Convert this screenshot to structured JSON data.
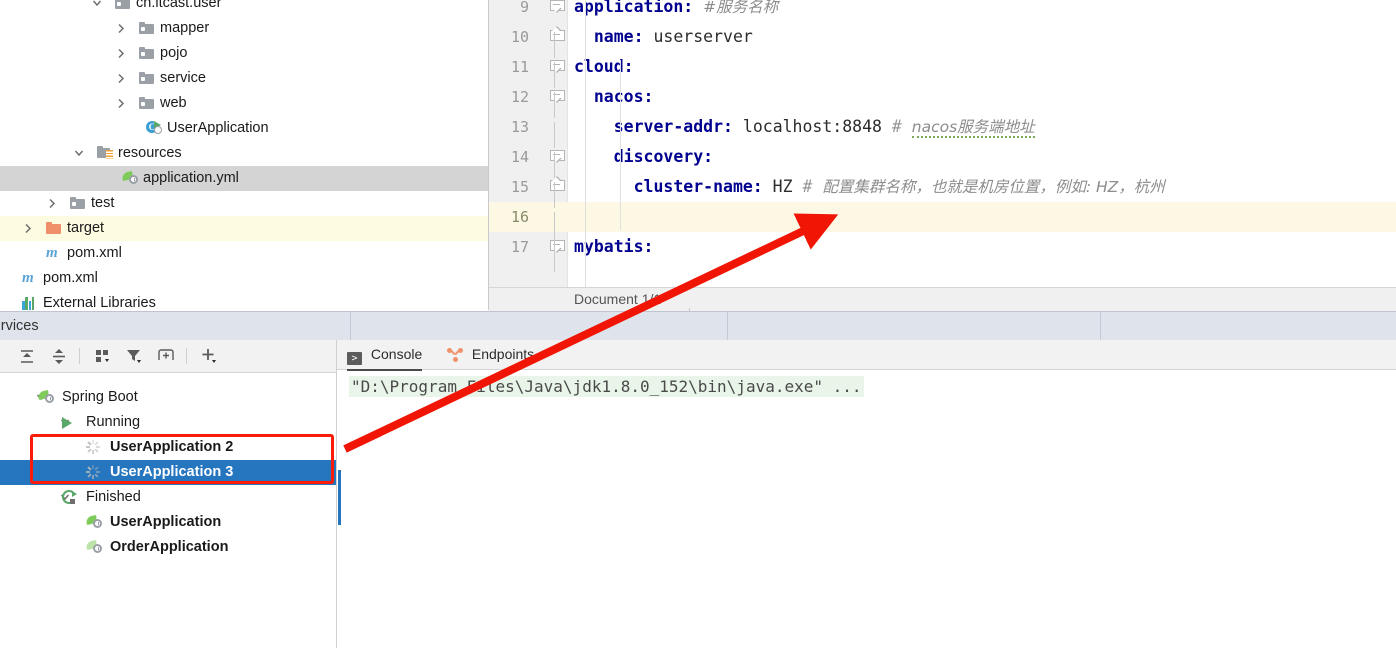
{
  "project_tree": {
    "rows": [
      {
        "label": "cn.itcast.user",
        "icon": "package-icon",
        "indent": 115,
        "arrow": "chevron-down",
        "state": "partial-top"
      },
      {
        "label": "mapper",
        "icon": "folder-grey-icon",
        "indent": 139,
        "arrow": "chevron-right"
      },
      {
        "label": "pojo",
        "icon": "folder-grey-icon",
        "indent": 139,
        "arrow": "chevron-right"
      },
      {
        "label": "service",
        "icon": "folder-grey-icon",
        "indent": 139,
        "arrow": "chevron-right"
      },
      {
        "label": "web",
        "icon": "folder-grey-icon",
        "indent": 139,
        "arrow": "chevron-right"
      },
      {
        "label": "UserApplication",
        "icon": "java-class-run-icon",
        "indent": 146,
        "arrow": ""
      },
      {
        "label": "resources",
        "icon": "folder-resources-icon",
        "indent": 97,
        "arrow": "chevron-down"
      },
      {
        "label": "application.yml",
        "icon": "spring-yaml-icon",
        "indent": 122,
        "arrow": "",
        "selected": true
      },
      {
        "label": "test",
        "icon": "folder-grey-icon",
        "indent": 70,
        "arrow": "chevron-right"
      },
      {
        "label": "target",
        "icon": "folder-orange-icon",
        "indent": 46,
        "arrow": "chevron-right",
        "highlighted": true
      },
      {
        "label": "pom.xml",
        "icon": "maven-m-icon",
        "indent": 46,
        "arrow": ""
      },
      {
        "label": "pom.xml",
        "icon": "maven-m-icon",
        "indent": 22,
        "arrow": ""
      },
      {
        "label": "External Libraries",
        "icon": "external-libraries-icon",
        "indent": 22,
        "arrow": ""
      }
    ]
  },
  "editor": {
    "lines": [
      {
        "num": "9",
        "indent": 0,
        "fold": "down",
        "parts": [
          {
            "t": "application:",
            "c": "k"
          },
          {
            "t": " ",
            "c": "v"
          },
          {
            "t": "#服务名称",
            "c": "cmw"
          }
        ]
      },
      {
        "num": "10",
        "indent": 0,
        "fold": "up",
        "parts": [
          {
            "t": "  name:",
            "c": "k"
          },
          {
            "t": " userserver",
            "c": "v"
          }
        ]
      },
      {
        "num": "11",
        "indent": 0,
        "fold": "down",
        "parts": [
          {
            "t": "cloud:",
            "c": "k"
          }
        ]
      },
      {
        "num": "12",
        "indent": 0,
        "fold": "down",
        "parts": [
          {
            "t": "  nacos:",
            "c": "k"
          }
        ]
      },
      {
        "num": "13",
        "indent": 0,
        "fold": "",
        "parts": [
          {
            "t": "    server-addr:",
            "c": "k"
          },
          {
            "t": " localhost:8848",
            "c": "v"
          },
          {
            "t": " # ",
            "c": "cm"
          },
          {
            "t": "nacos服务端地址",
            "c": "cmw"
          }
        ]
      },
      {
        "num": "14",
        "indent": 0,
        "fold": "down",
        "parts": [
          {
            "t": "    discovery:",
            "c": "k"
          }
        ]
      },
      {
        "num": "15",
        "indent": 0,
        "fold": "up",
        "parts": [
          {
            "t": "      cluster-name:",
            "c": "k"
          },
          {
            "t": " HZ",
            "c": "v"
          },
          {
            "t": " # ",
            "c": "cm"
          },
          {
            "t": "配置集群名称，也就是机房位置，例如: HZ，杭州",
            "c": "cmw"
          }
        ]
      },
      {
        "num": "16",
        "indent": 0,
        "fold": "",
        "parts": [],
        "highlighted": true
      },
      {
        "num": "17",
        "indent": 0,
        "fold": "down-left",
        "parts": [
          {
            "t": "mybatis:",
            "c": "k"
          }
        ]
      }
    ],
    "status": {
      "document_count": "Document 1/1"
    }
  },
  "services_header": {
    "title": "Services"
  },
  "services_toolbar": {
    "buttons": [
      {
        "name": "expand-all-icon",
        "label": "Expand All"
      },
      {
        "name": "collapse-all-icon",
        "label": "Collapse All"
      },
      {
        "name": "group-by-icon",
        "label": "Group By"
      },
      {
        "name": "filter-icon",
        "label": "Filter"
      },
      {
        "name": "add-tab-icon",
        "label": "Add Tab"
      },
      {
        "name": "add-service-icon",
        "label": "Add Service"
      }
    ]
  },
  "services_tree": {
    "rows": [
      {
        "label": "Spring Boot",
        "icon": "spring-boot-icon",
        "indent": 62,
        "arrow": "chevron-down",
        "bold": false
      },
      {
        "label": "Running",
        "icon": "run-play-icon",
        "indent": 86,
        "arrow": "chevron-down",
        "bold": false
      },
      {
        "label": "UserApplication 2",
        "icon": "spinner-icon",
        "indent": 110,
        "arrow": "",
        "bold": true
      },
      {
        "label": "UserApplication 3",
        "icon": "spinner-icon",
        "indent": 110,
        "arrow": "",
        "bold": true,
        "selected": true
      },
      {
        "label": "Finished",
        "icon": "rerun-icon",
        "indent": 86,
        "arrow": "chevron-down",
        "bold": false
      },
      {
        "label": "UserApplication",
        "icon": "spring-boot-icon",
        "indent": 110,
        "arrow": "",
        "bold": true
      },
      {
        "label": "OrderApplication",
        "icon": "spring-boot-pale-icon",
        "indent": 110,
        "arrow": "",
        "bold": true
      }
    ]
  },
  "console": {
    "tabs": [
      {
        "label": "Console",
        "icon": "console-icon",
        "active": true
      },
      {
        "label": "Endpoints",
        "icon": "endpoints-icon",
        "active": false
      }
    ],
    "output": "\"D:\\Program Files\\Java\\jdk1.8.0_152\\bin\\java.exe\" ..."
  },
  "annotations": {
    "red_box_color": "#fc1a08",
    "arrow_color": "#f01505",
    "selection_color": "#2675bf",
    "highlight_line_color": "#fcf8e3",
    "target_row_color": "#fdfbe0"
  }
}
